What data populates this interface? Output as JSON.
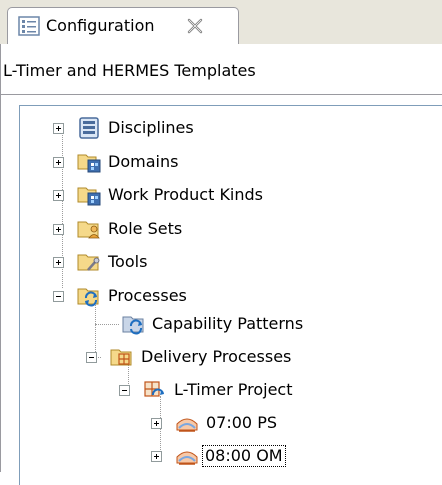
{
  "view_tab": {
    "title": "Configuration",
    "close_glyph": "✕"
  },
  "configuration": {
    "name": "L-Timer and HERMES Templates"
  },
  "tree": {
    "disciplines": "Disciplines",
    "domains": "Domains",
    "work_product_kinds": "Work Product Kinds",
    "role_sets": "Role Sets",
    "tools": "Tools",
    "processes": "Processes",
    "capability_patterns": "Capability Patterns",
    "delivery_processes": "Delivery Processes",
    "l_timer_project": "L-Timer Project",
    "iteration_0700": "07:00 PS",
    "iteration_0800": "08:00 OM"
  },
  "icons": {
    "view": "configuration-view-icon",
    "disciplines": "disciplines-icon",
    "domains": "domains-icon",
    "work_product_kinds": "work-product-kinds-icon",
    "role_sets": "role-sets-folder-icon",
    "tools": "tools-folder-icon",
    "processes": "processes-folder-icon",
    "capability_patterns": "capability-patterns-icon",
    "delivery_processes": "delivery-processes-icon",
    "l_timer_project": "delivery-process-icon",
    "iteration": "phase-icon"
  },
  "colors": {
    "tab_strip": "#e8e6dc",
    "tree_line": "#9c9c9c",
    "border": "#9a9aa0"
  }
}
